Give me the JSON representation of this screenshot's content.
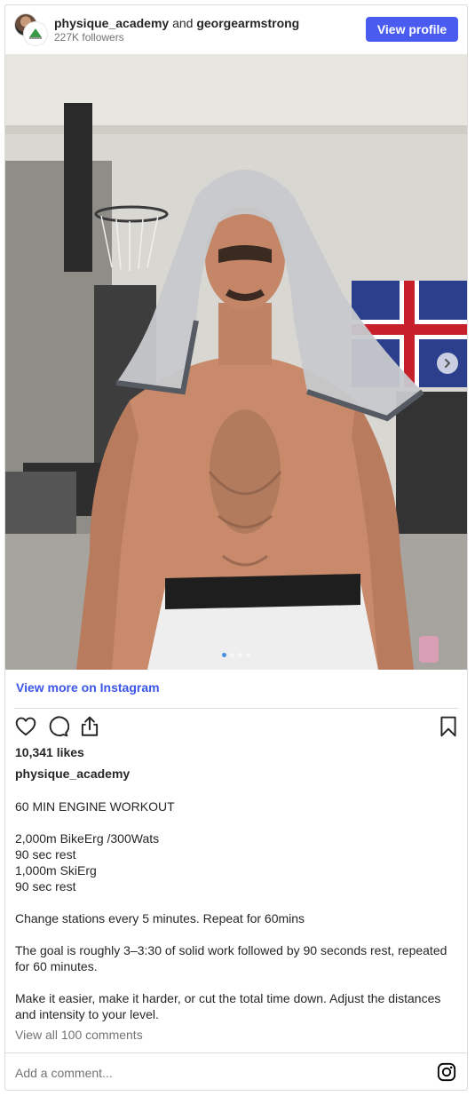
{
  "header": {
    "user1": "physique_academy",
    "and_text": "and",
    "user2": "georgearmstrong",
    "followers": "227K followers",
    "view_profile_label": "View profile"
  },
  "carousel": {
    "slide_count": 4,
    "active_index": 0
  },
  "colors": {
    "accent": "#4a5cf0",
    "link": "#3b56e8",
    "muted": "#737373",
    "border": "#dbdbdb"
  },
  "view_more_label": "View more on Instagram",
  "actions": {
    "icons": [
      "heart-icon",
      "comment-icon",
      "share-icon",
      "bookmark-icon"
    ]
  },
  "likes": "10,341 likes",
  "author": "physique_academy",
  "caption": {
    "title": "60 MIN ENGINE WORKOUT",
    "line1": "2,000m BikeErg /300Wats",
    "line2": "90 sec rest",
    "line3": "1,000m SkiErg",
    "line4": "90 sec rest",
    "para2": "Change stations every 5 minutes. Repeat for 60mins",
    "para3": "The goal is roughly 3–3:30 of solid work followed by 90 seconds rest, repeated for 60 minutes.",
    "para4": "Make it easier, make it harder, or cut the total time down. Adjust the distances and intensity to your level."
  },
  "view_comments_label": "View all 100 comments",
  "add_comment_placeholder": "Add a comment..."
}
